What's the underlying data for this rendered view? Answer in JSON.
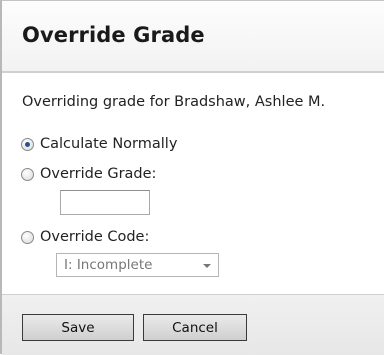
{
  "dialog": {
    "title": "Override Grade",
    "description": "Overriding grade for Bradshaw, Ashlee M.",
    "options": [
      {
        "label": "Calculate Normally",
        "checked": true
      },
      {
        "label": "Override Grade:",
        "checked": false
      },
      {
        "label": "Override Code:",
        "checked": false
      }
    ],
    "grade_input": {
      "value": "",
      "placeholder": ""
    },
    "code_select": {
      "selected": "I: Incomplete"
    },
    "buttons": {
      "save_label": "Save",
      "cancel_label": "Cancel"
    }
  }
}
